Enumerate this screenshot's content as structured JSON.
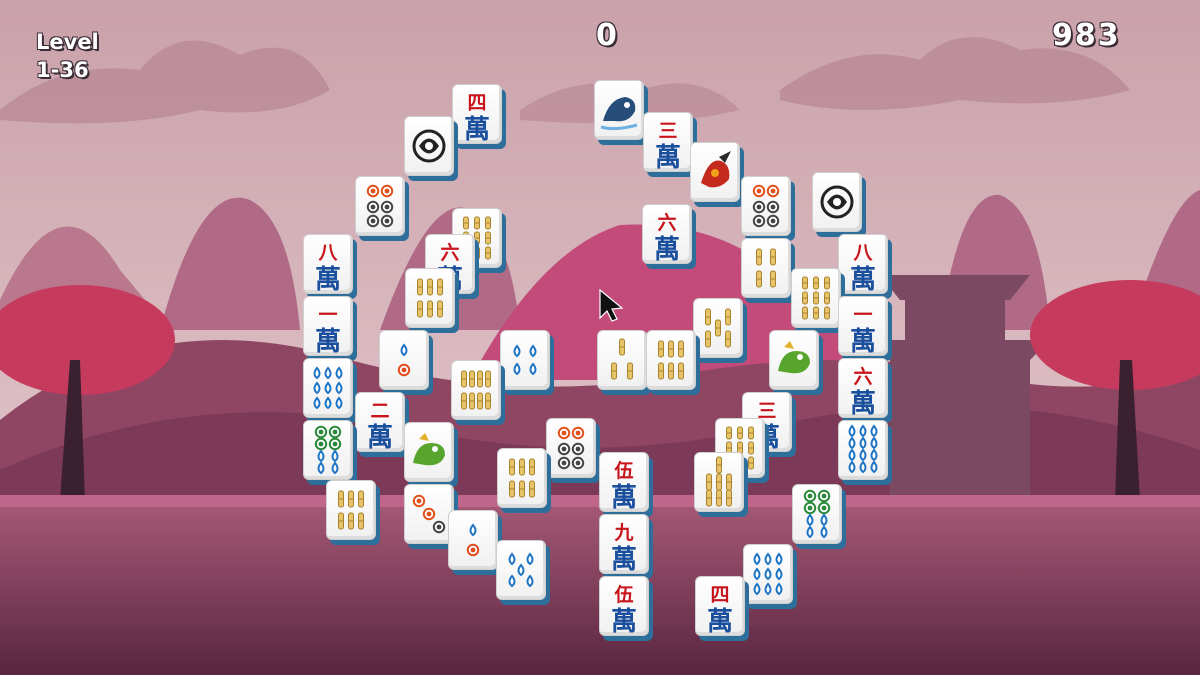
{
  "hud": {
    "level_label": "Level",
    "level_value": "1-36",
    "moves": "0",
    "score": "983"
  },
  "colors": {
    "sky": "#d9b7bd",
    "hills": "#b06a86",
    "ground": "#7a3a56",
    "tile_side": "#2d6f9a",
    "char_red": "#c8151b",
    "char_blue": "#1a4f9d"
  },
  "tiles": [
    {
      "kind": "char",
      "top": "四",
      "bot": "萬"
    },
    {
      "kind": "icon",
      "icon": "dragon-circle-icon"
    },
    {
      "kind": "icon",
      "icon": "dragon-blue-icon"
    },
    {
      "kind": "char",
      "top": "三",
      "bot": "萬"
    },
    {
      "kind": "icon",
      "icon": "phoenix-icon"
    },
    {
      "kind": "dots",
      "icon": "dots-6-icon"
    },
    {
      "kind": "icon",
      "icon": "dragon-circle-icon"
    },
    {
      "kind": "dots",
      "icon": "dots-6-icon"
    },
    {
      "kind": "bamboo",
      "icon": "bamboo-9-icon"
    },
    {
      "kind": "char",
      "top": "六",
      "bot": "萬"
    },
    {
      "kind": "char",
      "top": "六",
      "bot": "萬"
    },
    {
      "kind": "bamboo",
      "icon": "bamboo-6-icon"
    },
    {
      "kind": "char",
      "top": "八",
      "bot": "萬"
    },
    {
      "kind": "char",
      "top": "八",
      "bot": "萬"
    },
    {
      "kind": "bamboo",
      "icon": "bamboo-4-icon"
    },
    {
      "kind": "bamboo",
      "icon": "bamboo-9-icon"
    },
    {
      "kind": "char",
      "top": "一",
      "bot": "萬"
    },
    {
      "kind": "char",
      "top": "一",
      "bot": "萬"
    },
    {
      "kind": "dots",
      "icon": "dots-2-icon"
    },
    {
      "kind": "dots",
      "icon": "dots-4-icon"
    },
    {
      "kind": "bamboo",
      "icon": "bamboo-3-icon"
    },
    {
      "kind": "icon",
      "icon": "bamboo-bird-icon"
    },
    {
      "kind": "bamboo",
      "icon": "bamboo-5-icon"
    },
    {
      "kind": "icon",
      "icon": "dragon-green-icon"
    },
    {
      "kind": "dots",
      "icon": "dots-9-icon"
    },
    {
      "kind": "bamboo",
      "icon": "bamboo-8-icon"
    },
    {
      "kind": "char",
      "top": "六",
      "bot": "萬"
    },
    {
      "kind": "char",
      "top": "二",
      "bot": "萬"
    },
    {
      "kind": "char",
      "top": "三",
      "bot": "萬"
    },
    {
      "kind": "dots",
      "icon": "dots-8-icon"
    },
    {
      "kind": "icon",
      "icon": "dragon-green-icon"
    },
    {
      "kind": "dots",
      "icon": "dots-6-icon"
    },
    {
      "kind": "bamboo",
      "icon": "bamboo-6-icon"
    },
    {
      "kind": "char",
      "top": "伍",
      "bot": "萬"
    },
    {
      "kind": "bamboo",
      "icon": "bamboo-7-icon"
    },
    {
      "kind": "bamboo",
      "icon": "bamboo-9-icon"
    },
    {
      "kind": "dots",
      "icon": "dots-12-icon"
    },
    {
      "kind": "bamboo",
      "icon": "bamboo-6-icon"
    },
    {
      "kind": "dots",
      "icon": "dots-3-icon"
    },
    {
      "kind": "dots",
      "icon": "dots-8-icon"
    },
    {
      "kind": "char",
      "top": "九",
      "bot": "萬"
    },
    {
      "kind": "dots",
      "icon": "dots-2-icon"
    },
    {
      "kind": "dots",
      "icon": "dots-5-icon"
    },
    {
      "kind": "char",
      "top": "伍",
      "bot": "萬"
    },
    {
      "kind": "char",
      "top": "四",
      "bot": "萬"
    },
    {
      "kind": "dots",
      "icon": "dots-9-icon"
    }
  ]
}
